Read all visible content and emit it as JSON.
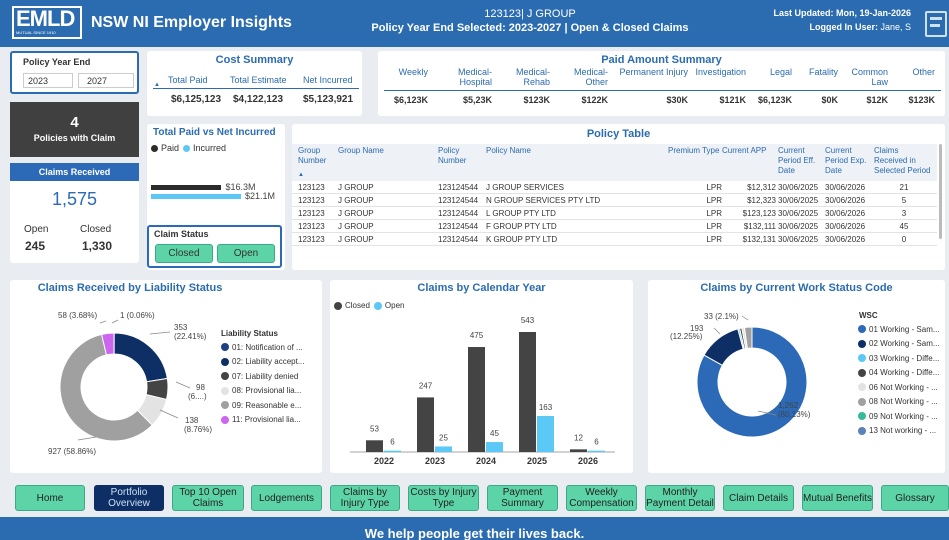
{
  "header": {
    "logo_text": "EMLD",
    "logo_sub": "MUTUAL SINCE 1910",
    "title": "NSW NI Employer Insights",
    "group_line": "123123| J GROUP",
    "policy_line": "Policy Year End Selected: 2023-2027 | Open & Closed Claims",
    "last_updated": "Last Updated: Mon, 19-Jan-2026",
    "logged_in": "Logged In User: Jane, S"
  },
  "filter": {
    "title": "Policy Year End",
    "from": "2023",
    "to": "2027"
  },
  "kpi": {
    "policies_count": "4",
    "policies_label": "Policies with Claim",
    "claims_received_label": "Claims Received",
    "claims_received_value": "1,575",
    "open_label": "Open",
    "closed_label": "Closed",
    "open_value": "245",
    "closed_value": "1,330"
  },
  "cost_summary": {
    "title": "Cost Summary",
    "headers": [
      "Total Paid",
      "Total Estimate",
      "Net Incurred"
    ],
    "values": [
      "$6,125,123",
      "$4,122,123",
      "$5,123,921"
    ]
  },
  "paid_summary": {
    "title": "Paid Amount Summary",
    "headers": [
      "Weekly",
      "Medical-Hospital",
      "Medical-Rehab",
      "Medical-Other",
      "Permanent Injury",
      "Investigation",
      "Legal",
      "Fatality",
      "Common Law",
      "Other"
    ],
    "values": [
      "$6,123K",
      "$5,23K",
      "$123K",
      "$122K",
      "$30K",
      "$121K",
      "$6,123K",
      "$0K",
      "$12K",
      "$123K"
    ]
  },
  "paid_vs_incurred": {
    "title": "Total Paid vs Net Incurred",
    "legend_paid": "Paid",
    "legend_incurred": "Incurred",
    "paid_label": "$16.3M",
    "incurred_label": "$21.1M",
    "paid_value": 16.3,
    "incurred_value": 21.1,
    "paid_color": "#2b2b2b",
    "incurred_color": "#5bc8f5"
  },
  "claim_status": {
    "title": "Claim Status",
    "closed_button": "Closed",
    "open_button": "Open"
  },
  "policy_table": {
    "title": "Policy Table",
    "headers": [
      "Group Number",
      "Group Name",
      "Policy Number",
      "Policy Name",
      "Premium Type",
      "Current APP",
      "Current Period Eff. Date",
      "Current Period Exp. Date",
      "Claims Received in Selected Period"
    ],
    "rows": [
      [
        "123123",
        "J GROUP",
        "123124544",
        "J GROUP SERVICES",
        "LPR",
        "$12,312",
        "30/06/2025",
        "30/06/2026",
        "21"
      ],
      [
        "123123",
        "J GROUP",
        "123124544",
        "N GROUP SERVICES PTY LTD",
        "LPR",
        "$12,323",
        "30/06/2025",
        "30/06/2026",
        "5"
      ],
      [
        "123123",
        "J GROUP",
        "123124544",
        "L GROUP PTY LTD",
        "LPR",
        "$123,123",
        "30/06/2025",
        "30/06/2026",
        "3"
      ],
      [
        "123123",
        "J GROUP",
        "123124544",
        "F GROUP PTY LTD",
        "LPR",
        "$132,111",
        "30/06/2025",
        "30/06/2026",
        "45"
      ],
      [
        "123123",
        "J GROUP",
        "123124544",
        "K GROUP PTY LTD",
        "LPR",
        "$132,131",
        "30/06/2025",
        "30/06/2026",
        "0"
      ]
    ]
  },
  "liability_chart": {
    "title": "Claims Received by Liability Status",
    "legend_title": "Liability Status",
    "legend": [
      {
        "label": "01: Notification of ...",
        "color": "#1f3f80"
      },
      {
        "label": "02: Liability accept...",
        "color": "#0d2f66"
      },
      {
        "label": "07: Liability denied",
        "color": "#444444"
      },
      {
        "label": "08: Provisional lia...",
        "color": "#e3e3e3"
      },
      {
        "label": "09: Reasonable e...",
        "color": "#a0a0a0"
      },
      {
        "label": "11: Provisional lia...",
        "color": "#cc66ee"
      }
    ],
    "labels": [
      "58 (3.68%)",
      "1 (0.06%)",
      "353",
      "(22.41%)",
      "98",
      "(6....)",
      "138",
      "(8.76%)",
      "927 (58.86%)"
    ]
  },
  "calendar_chart": {
    "title": "Claims by Calendar Year",
    "legend_closed": "Closed",
    "legend_open": "Open",
    "closed_color": "#444444",
    "open_color": "#5bc8f5"
  },
  "wsc_chart": {
    "title": "Claims by Current Work Status Code",
    "legend_title": "WSC",
    "legend": [
      {
        "label": "01 Working - Sam...",
        "color": "#2c6ab8"
      },
      {
        "label": "02 Working - Sam...",
        "color": "#0d2f66"
      },
      {
        "label": "03 Working - Diffe...",
        "color": "#5bc8f5"
      },
      {
        "label": "04 Working - Diffe...",
        "color": "#444444"
      },
      {
        "label": "06 Not Working - ...",
        "color": "#e3e3e3"
      },
      {
        "label": "08 Not Working - ...",
        "color": "#a0a0a0"
      },
      {
        "label": "09 Not Working - ...",
        "color": "#3ab89a"
      },
      {
        "label": "13 Not working - ...",
        "color": "#5a82b8"
      }
    ],
    "labels": [
      "33 (2.1%)",
      "193",
      "(12.25%)",
      "1,262",
      "(80.13%)"
    ]
  },
  "nav": {
    "home": "Home",
    "portfolio": "Portfolio Overview",
    "top10": "Top 10 Open Claims",
    "lodgements": "Lodgements",
    "by_injury_type": "Claims by Injury Type",
    "costs_by_injury": "Costs by Injury Type",
    "payment_summary": "Payment Summary",
    "weekly_comp": "Weekly Compensation",
    "monthly_payment": "Monthly Payment Detail",
    "claim_details": "Claim Details",
    "mutual_benefits": "Mutual Benefits",
    "glossary": "Glossary"
  },
  "footer": {
    "tagline": "We help people get their lives back."
  },
  "chart_data": [
    {
      "type": "pie",
      "title": "Claims Received by Liability Status",
      "categories": [
        "01: Notification of ...",
        "02: Liability accept...",
        "07: Liability denied",
        "08: Provisional lia...",
        "09: Reasonable e...",
        "11: Provisional lia..."
      ],
      "values": [
        1,
        353,
        98,
        138,
        927,
        58
      ]
    },
    {
      "type": "bar",
      "title": "Claims by Calendar Year",
      "categories": [
        "2022",
        "2023",
        "2024",
        "2025",
        "2026"
      ],
      "series": [
        {
          "name": "Closed",
          "values": [
            53,
            247,
            475,
            543,
            12
          ]
        },
        {
          "name": "Open",
          "values": [
            6,
            25,
            45,
            163,
            6
          ]
        }
      ]
    },
    {
      "type": "pie",
      "title": "Claims by Current Work Status Code",
      "categories": [
        "01 Working - Sam...",
        "02 Working - Sam...",
        "03 Working - Diffe...",
        "04 Working - Diffe...",
        "06 Not Working - ...",
        "08 Not Working - ..."
      ],
      "values": [
        1262,
        193,
        8,
        10,
        12,
        33
      ]
    }
  ]
}
